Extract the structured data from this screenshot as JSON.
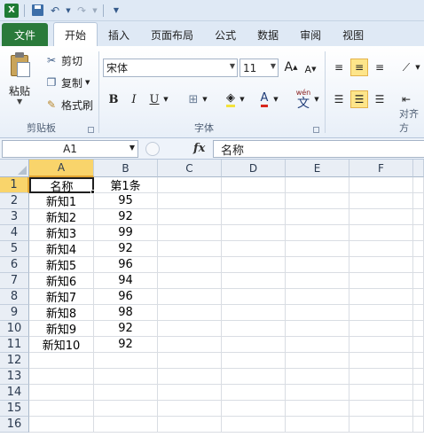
{
  "quick_access": {
    "app_icon": "excel-icon",
    "save_icon": "save-icon",
    "undo_icon": "undo-icon",
    "redo_icon": "redo-icon",
    "customize_icon": "customize-icon"
  },
  "tabs": {
    "file": "文件",
    "home": "开始",
    "insert": "插入",
    "page_layout": "页面布局",
    "formulas": "公式",
    "data": "数据",
    "review": "审阅",
    "view": "视图"
  },
  "ribbon": {
    "clipboard": {
      "paste": "粘贴",
      "cut": "剪切",
      "copy": "复制",
      "format_painter": "格式刷",
      "group_label": "剪贴板"
    },
    "font": {
      "font_name": "宋体",
      "font_size": "11",
      "bold": "B",
      "italic": "I",
      "underline": "U",
      "font_color_letter": "A",
      "grow": "A",
      "shrink": "A",
      "phonetic": "wén",
      "phonetic_char": "文",
      "group_label": "字体"
    },
    "alignment": {
      "group_label": "对齐方"
    }
  },
  "formula_bar": {
    "name_box": "A1",
    "fx": "fx",
    "content": "名称"
  },
  "sheet": {
    "columns": [
      "A",
      "B",
      "C",
      "D",
      "E",
      "F"
    ],
    "row_numbers": [
      "1",
      "2",
      "3",
      "4",
      "5",
      "6",
      "7",
      "8",
      "9",
      "10",
      "11",
      "12",
      "13",
      "14",
      "15",
      "16"
    ],
    "headers": [
      "名称",
      "第1条"
    ],
    "rows": [
      [
        "新知1",
        "95"
      ],
      [
        "新知2",
        "92"
      ],
      [
        "新知3",
        "99"
      ],
      [
        "新知4",
        "92"
      ],
      [
        "新知5",
        "96"
      ],
      [
        "新知6",
        "94"
      ],
      [
        "新知7",
        "96"
      ],
      [
        "新知8",
        "98"
      ],
      [
        "新知9",
        "92"
      ],
      [
        "新知10",
        "92"
      ]
    ],
    "active_cell": "A1",
    "selection_color": "#f9d46b"
  }
}
